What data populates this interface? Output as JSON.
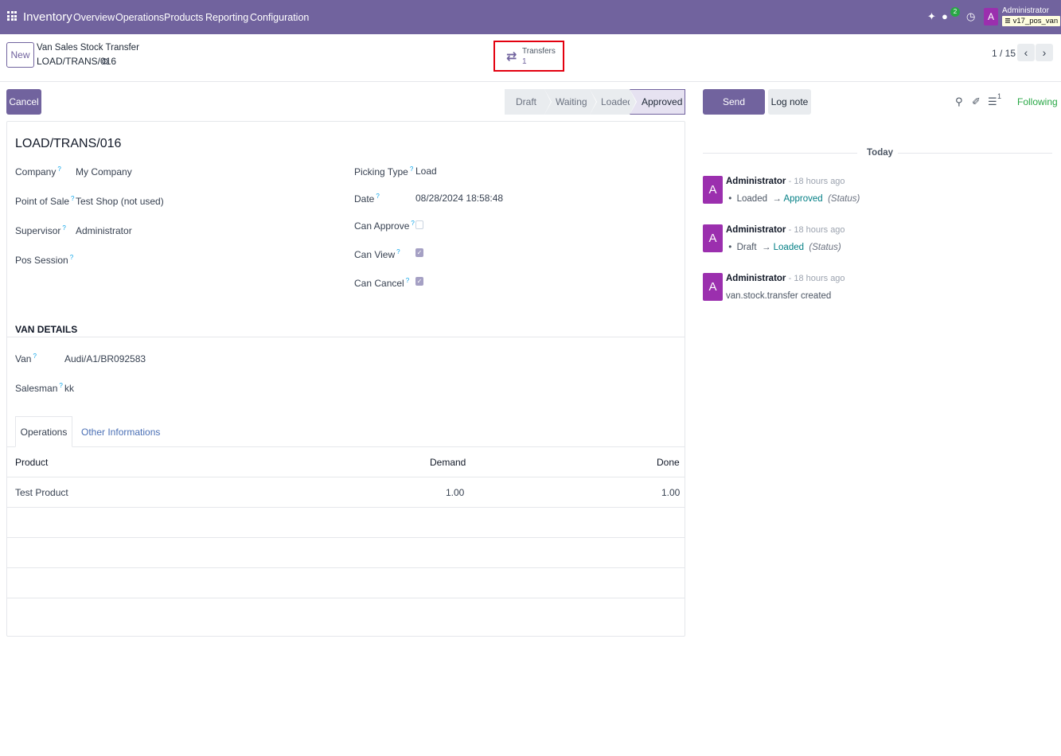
{
  "navbar": {
    "app_name": "Inventory",
    "menu": [
      "Overview",
      "Operations",
      "Products",
      "Reporting",
      "Configuration"
    ],
    "message_count": "2",
    "avatar_letter": "A",
    "user_name": "Administrator",
    "database": "v17_pos_van"
  },
  "control_panel": {
    "new_label": "New",
    "breadcrumb_parent": "Van Sales Stock Transfer",
    "breadcrumb_current": "LOAD/TRANS/016",
    "smart_button": {
      "label": "Transfers",
      "value": "1"
    },
    "pager": "1 / 15"
  },
  "statusbar": {
    "cancel_label": "Cancel",
    "stages": [
      "Draft",
      "Waiting",
      "Loaded",
      "Approved"
    ],
    "active_stage": "Approved"
  },
  "form": {
    "title": "LOAD/TRANS/016",
    "left_fields": [
      {
        "label": "Company",
        "value": "My Company"
      },
      {
        "label": "Point of Sale",
        "value": "Test Shop (not used)"
      },
      {
        "label": "Supervisor",
        "value": "Administrator"
      },
      {
        "label": "Pos Session",
        "value": ""
      }
    ],
    "right_fields": [
      {
        "label": "Picking Type",
        "value": "Load"
      },
      {
        "label": "Date",
        "value": "08/28/2024 18:58:48"
      },
      {
        "label": "Can Approve",
        "checked": false
      },
      {
        "label": "Can View",
        "checked": true
      },
      {
        "label": "Can Cancel",
        "checked": true
      }
    ],
    "help_mark": "?",
    "van_details": {
      "title": "VAN DETAILS",
      "fields": [
        {
          "label": "Van",
          "value": "Audi/A1/BR092583"
        },
        {
          "label": "Salesman",
          "value": "kk"
        }
      ]
    },
    "tabs": [
      "Operations",
      "Other Informations"
    ],
    "table": {
      "headers": [
        "Product",
        "Demand",
        "Done"
      ],
      "rows": [
        {
          "product": "Test Product",
          "demand": "1.00",
          "done": "1.00"
        }
      ]
    }
  },
  "chatter": {
    "send_label": "Send message",
    "log_label": "Log note",
    "follower_count": "1",
    "following_label": "Following",
    "date_separator": "Today",
    "messages": [
      {
        "avatar": "A",
        "author": "Administrator",
        "time": "- 18 hours ago",
        "old": "Loaded",
        "new": "Approved",
        "field": "(Status)"
      },
      {
        "avatar": "A",
        "author": "Administrator",
        "time": "- 18 hours ago",
        "old": "Draft",
        "new": "Loaded",
        "field": "(Status)"
      },
      {
        "avatar": "A",
        "author": "Administrator",
        "time": "- 18 hours ago",
        "text": "van.stock.transfer created"
      }
    ]
  }
}
